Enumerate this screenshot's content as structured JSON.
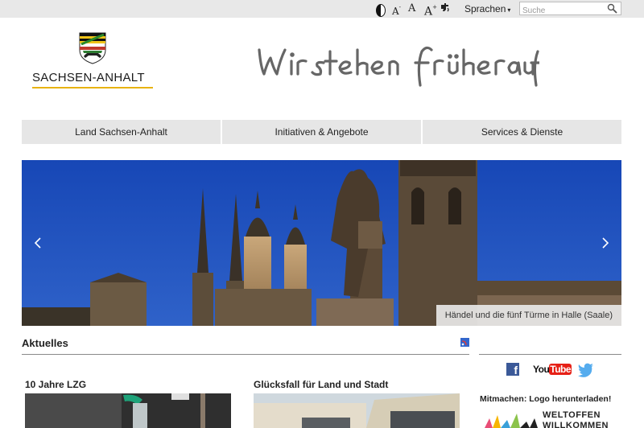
{
  "topbar": {
    "contrast_icon": "contrast-icon",
    "font_small_label": "A",
    "font_small_sup": "-",
    "font_normal_label": "A",
    "font_large_label": "A",
    "font_large_sup": "+",
    "speech_icon": "speech-icon",
    "language_label": "Sprachen",
    "language_caret": "▾",
    "search_placeholder": "Suche",
    "search_icon": "magnifier-icon"
  },
  "logo": {
    "name": "SACHSEN-ANHALT",
    "accent_color": "#e8b30f"
  },
  "slogan": "Wir stehen früher auf",
  "nav": [
    {
      "label": "Land Sachsen-Anhalt"
    },
    {
      "label": "Initiativen & Angebote"
    },
    {
      "label": "Services & Dienste"
    }
  ],
  "hero": {
    "caption": "Händel und die fünf Türme in Halle (Saale)",
    "prev_icon": "chevron-left-icon",
    "next_icon": "chevron-right-icon",
    "sky_color": "#1d4bb0"
  },
  "news": {
    "heading": "Aktuelles",
    "rss_icon": "rss-icon",
    "items": [
      {
        "title": "10 Jahre LZG"
      },
      {
        "title": "Glücksfall für Land und Stadt"
      }
    ]
  },
  "sidebar": {
    "social": [
      "facebook-icon",
      "youtube-icon",
      "twitter-icon"
    ],
    "youtube_you": "You",
    "youtube_tube": "Tube",
    "facebook_letter": "f",
    "logo_download": "Mitmachen: Logo herunterladen!",
    "weltoffen_line1": "WELTOFFEN",
    "weltoffen_line2": "WILLKOMMEN"
  }
}
